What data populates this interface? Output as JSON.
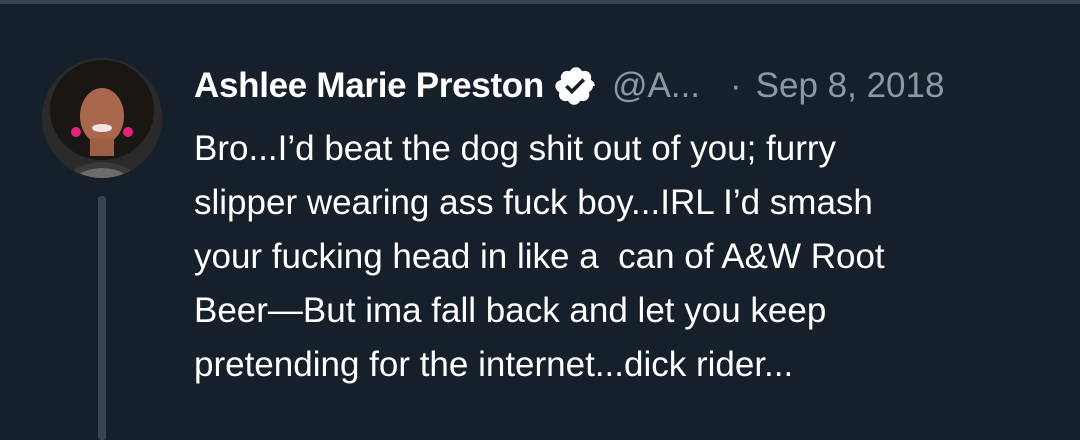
{
  "colors": {
    "background": "#15202b",
    "primary_text": "#ffffff",
    "secondary_text": "#8b98a5",
    "divider": "#38444d"
  },
  "tweet": {
    "avatar_icon": "profile-photo",
    "display_name": "Ashlee Marie Preston",
    "verified_icon": "verified-badge-icon",
    "handle": "@A...",
    "separator": "·",
    "date": "Sep 8, 2018",
    "text_lines": [
      "Bro...I’d beat the dog shit out of you; furry",
      "slipper wearing ass fuck boy...IRL I’d smash",
      "your fucking head in like a  can of A&W Root",
      "Beer—But ima fall back and let you keep",
      "pretending for the internet...dick rider..."
    ]
  }
}
